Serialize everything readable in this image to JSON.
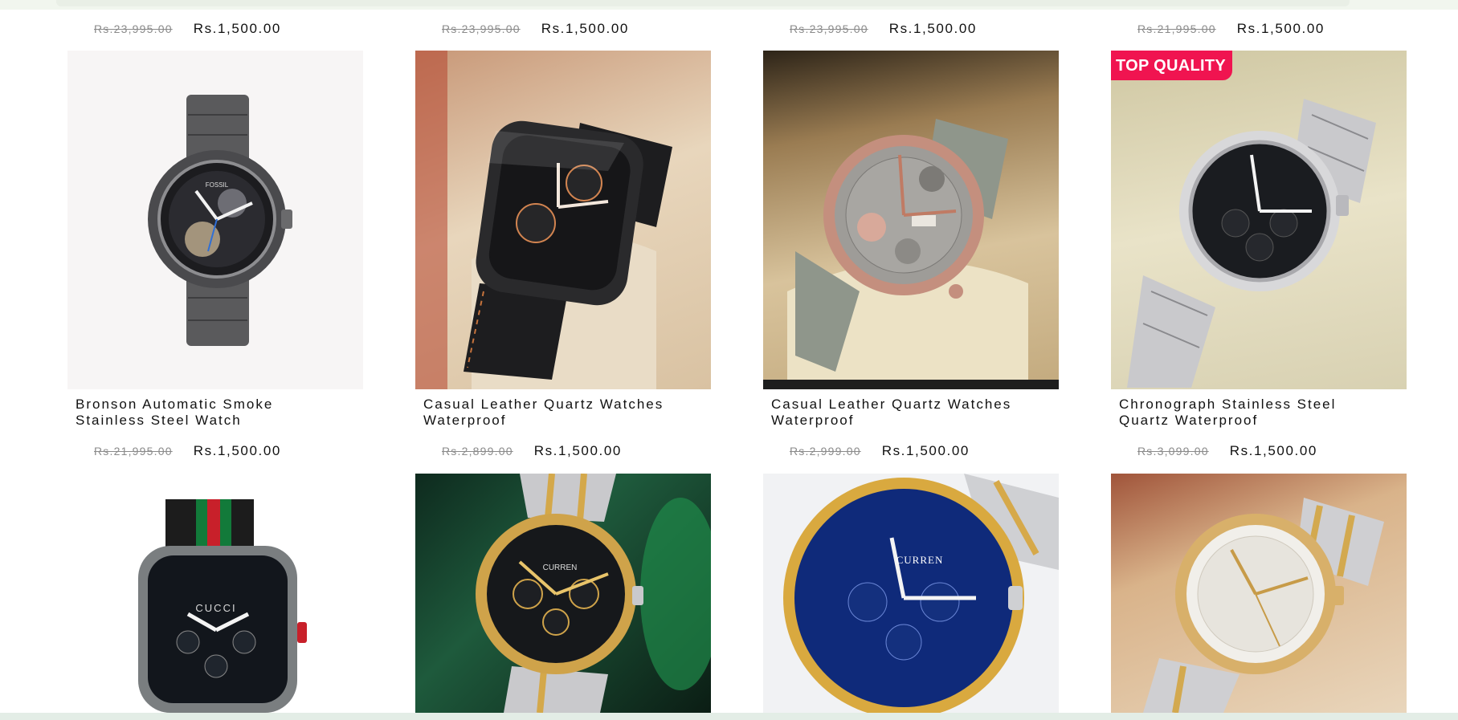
{
  "price_rows": [
    [
      {
        "old": "Rs.23,995.00",
        "new": "Rs.1,500.00"
      },
      {
        "old": "Rs.23,995.00",
        "new": "Rs.1,500.00"
      },
      {
        "old": "Rs.23,995.00",
        "new": "Rs.1,500.00"
      },
      {
        "old": "Rs.21,995.00",
        "new": "Rs.1,500.00"
      }
    ],
    [
      {
        "old": "Rs.21,995.00",
        "new": "Rs.1,500.00"
      },
      {
        "old": "Rs.2,899.00",
        "new": "Rs.1,500.00"
      },
      {
        "old": "Rs.2,999.00",
        "new": "Rs.1,500.00"
      },
      {
        "old": "Rs.3,099.00",
        "new": "Rs.1,500.00"
      }
    ]
  ],
  "products": [
    {
      "title": "Bronson Automatic Smoke Stainless Steel Watch",
      "image": "gunmetal-skeleton-watch-image",
      "dial_text": "FOSSIL"
    },
    {
      "title": "Casual Leather Quartz Watches Waterproof",
      "image": "black-square-leather-watch-image"
    },
    {
      "title": "Casual Leather Quartz Watches Waterproof",
      "image": "rosegold-grey-strap-watch-image"
    },
    {
      "title": "Chronograph Stainless Steel Quartz Waterproof",
      "image": "silver-black-chronograph-watch-image",
      "badge": "TOP QUALITY"
    },
    {
      "title": "",
      "image": "square-striped-strap-watch-image",
      "dial_text": "CUCCI"
    },
    {
      "title": "",
      "image": "gold-roman-chronograph-watch-image",
      "dial_text": "CURREN"
    },
    {
      "title": "",
      "image": "blue-gold-chronograph-watch-image",
      "dial_text": "CURREN"
    },
    {
      "title": "",
      "image": "gold-white-dial-watch-image"
    }
  ]
}
